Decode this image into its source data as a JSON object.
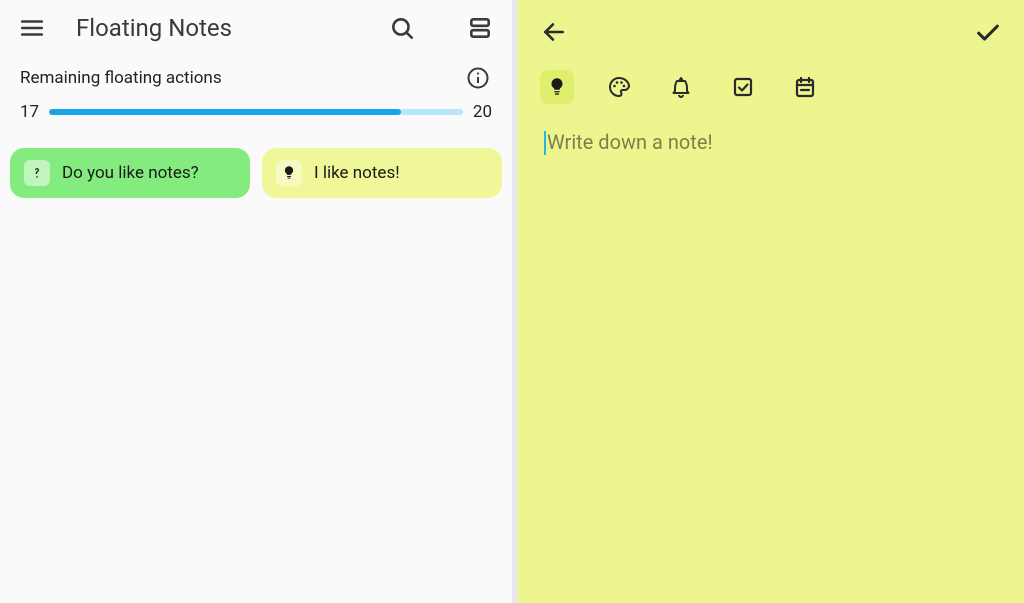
{
  "header": {
    "title": "Floating Notes"
  },
  "progress": {
    "label": "Remaining floating actions",
    "current": "17",
    "max": "20",
    "percent": 85
  },
  "notes": [
    {
      "text": "Do you like notes?",
      "kind": "question",
      "color": "green"
    },
    {
      "text": "I like notes!",
      "kind": "idea",
      "color": "yellow"
    }
  ],
  "editor": {
    "placeholder": "Write down a note!",
    "tools": {
      "idea": "idea",
      "palette": "palette",
      "reminder": "reminder",
      "checkbox": "checkbox",
      "calendar": "calendar"
    }
  }
}
